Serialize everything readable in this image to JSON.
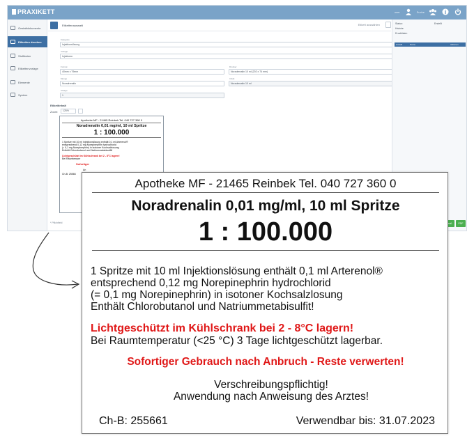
{
  "app": {
    "brand": "PRAXIKETT",
    "user_text": "user",
    "user2_text": "Suche",
    "header_title": "Etikettenauswahl",
    "header_right": "Etikett auswählen",
    "sidebar": [
      {
        "label": "Gestaltdokumente"
      },
      {
        "label": "Etiketten drucken"
      },
      {
        "label": "Stoffdaten"
      },
      {
        "label": "Etikettenvorlage"
      },
      {
        "label": "Elemente"
      },
      {
        "label": "System"
      }
    ],
    "fields": {
      "kategorie_label": "Kategorie",
      "kategorie_value": "Injektionslösung",
      "vorlage_label": "Vorlage",
      "vorlage_value": "Injektoren",
      "format_label": "Format",
      "format_value": "40mm x 79mm",
      "drucker_label": "Drucker",
      "drucker_value": "Noradrenalin 10 ml (202 x 74 mm)",
      "menge_label": "Menge",
      "menge_value": "Noradrenalin",
      "inhalt_label": "Inhalt",
      "inhalt_value": "Noradrenalin 10 ml",
      "charge_label": "Charge",
      "charge_value": "1"
    },
    "preview_label": "Etikettinhalt",
    "zoom_label": "Zoom:",
    "zoom_value": "125%",
    "footnote": "* Pflichtfeld",
    "right_panel": {
      "row1_left": "Status:",
      "row1_right": "Erstellt",
      "row2": "Historie",
      "row3": "Drucklisten",
      "table_col1": "Anzahl",
      "table_col2": "Name",
      "table_col3": "Aktionen",
      "btn1": "Menü",
      "btn2": "PDF"
    }
  },
  "label": {
    "pharmacy": "Apotheke MF - 21465 Reinbek Tel. 040 727 360 0",
    "product": "Noradrenalin 0,01 mg/ml, 10 ml Spritze",
    "dilution": "1 : 100.000",
    "desc1": "1 Spritze mit 10 ml Injektionslösung enthält 0,1 ml Arterenol®",
    "desc2": "entsprechend 0,12 mg Norepinephrin hydrochlorid",
    "desc3": "(= 0,1 mg Norepinephrin) in isotoner Kochsalzlosung",
    "desc4": "Enthält Chlorobutanol und Natriummetabisulfit!",
    "storage_warning": "Lichtgeschützt im Kühlschrank bei 2 - 8°C lagern!",
    "storage_note": "Bei Raumtemperatur (<25 °C) 3 Tage lichtgeschützt lagerbar.",
    "use_warning": "Sofortiger Gebrauch nach Anbruch - Reste verwerten!",
    "rx1": "Verschreibungspflichtig!",
    "rx2": "Anwendung nach Anweisung des Arztes!",
    "batch": "Ch-B: 255661",
    "expiry": "Verwendbar bis: 31.07.2023"
  },
  "mini_label": {
    "storage_warning": "Lichtgeschützt im Kühlschrank bei 2 - 8°C lagern!",
    "storage_note": "Bei Raumtemper",
    "use_warning": "Sofortiger",
    "rx_fragment": "An",
    "batch": "Ch-B: 25566"
  },
  "colors": {
    "topbar": "#7aa3c8",
    "sidebar_active": "#3d6fa3",
    "warning_red": "#e01818",
    "button_green": "#4caf50"
  }
}
